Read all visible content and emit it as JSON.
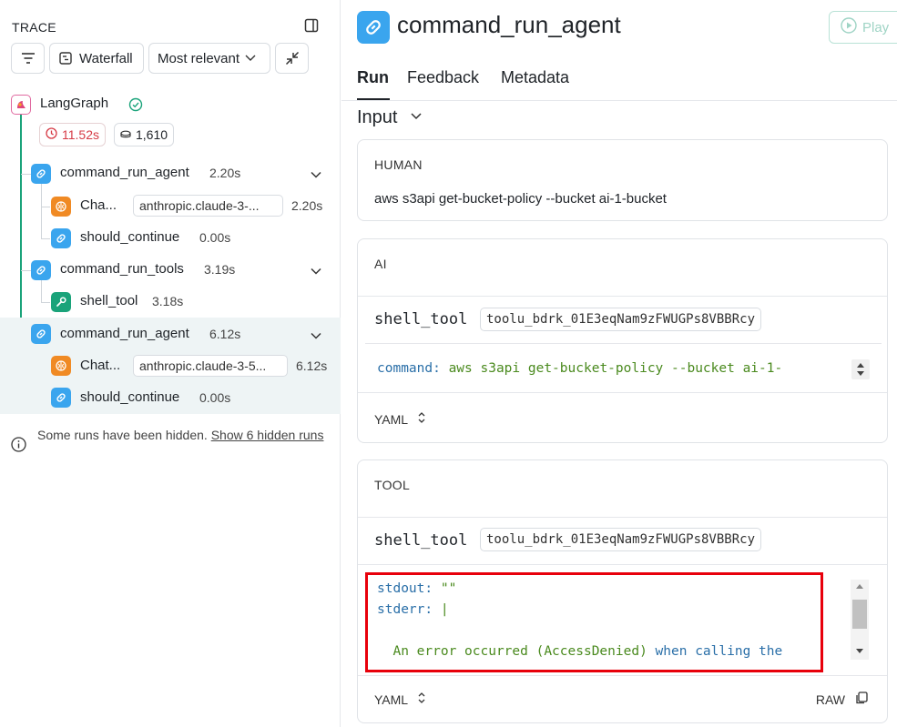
{
  "left": {
    "trace_title": "TRACE",
    "toolbar": {
      "waterfall_label": "Waterfall",
      "sort_label": "Most relevant"
    },
    "root": {
      "label": "LangGraph",
      "latency": "11.52s",
      "tokens": "1,610"
    },
    "rows": [
      {
        "label": "command_run_agent",
        "time": "2.20s"
      },
      {
        "label": "Cha...",
        "model": "anthropic.claude-3-...",
        "time": "2.20s"
      },
      {
        "label": "should_continue",
        "time": "0.00s"
      },
      {
        "label": "command_run_tools",
        "time": "3.19s"
      },
      {
        "label": "shell_tool",
        "time": "3.18s"
      },
      {
        "label": "command_run_agent",
        "time": "6.12s"
      },
      {
        "label": "Chat...",
        "model": "anthropic.claude-3-5...",
        "time": "6.12s"
      },
      {
        "label": "should_continue",
        "time": "0.00s"
      }
    ],
    "hidden_note": {
      "text": "Some runs have been hidden. ",
      "link": "Show 6 hidden runs"
    }
  },
  "right": {
    "title": "command_run_agent",
    "play_label": "Play",
    "tabs": [
      "Run",
      "Feedback",
      "Metadata"
    ],
    "input_heading": "Input",
    "human": {
      "label": "HUMAN",
      "text": "aws s3api get-bucket-policy --bucket ai-1-bucket"
    },
    "ai": {
      "label": "AI",
      "tool_name": "shell_tool",
      "tool_id": "toolu_bdrk_01E3eqNam9zFWUGPs8VBBRcy",
      "code_key": "command:",
      "code_value": " aws s3api get-bucket-policy --bucket ai-1-",
      "format": "YAML"
    },
    "tool": {
      "label": "TOOL",
      "tool_name": "shell_tool",
      "tool_id": "toolu_bdrk_01E3eqNam9zFWUGPs8VBBRcy",
      "stdout_key": "stdout:",
      "stdout_value": " \"\"",
      "stderr_key": "stderr:",
      "stderr_value": " |",
      "error_part1": "  An error occurred (AccessDenied)",
      "error_part2": " when calling the",
      "format": "YAML",
      "raw_label": "RAW"
    }
  }
}
